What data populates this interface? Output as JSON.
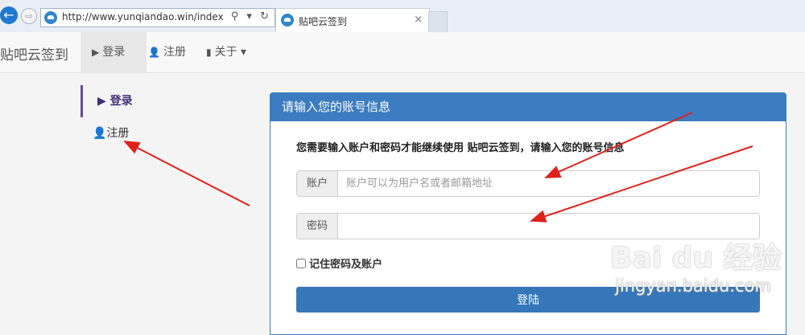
{
  "browser": {
    "url": "http://www.yunqiandao.win/index.ph",
    "tab_title": "贴吧云签到",
    "tab_close": "×",
    "toolbar_glyphs": "⚲ ▾ ↻",
    "back_glyph": "←",
    "forward_glyph": "⇨"
  },
  "navbar": {
    "brand": "贴吧云签到",
    "items": [
      {
        "label": "登录",
        "icon": "play-icon",
        "glyph": "▶"
      },
      {
        "label": "注册",
        "icon": "user-icon",
        "glyph": "👤"
      },
      {
        "label": "关于 ▾",
        "icon": "book-icon",
        "glyph": "▮"
      }
    ]
  },
  "sidenav": {
    "items": [
      {
        "label": "登录",
        "glyph": "▶"
      },
      {
        "label": "注册",
        "glyph": "👤"
      }
    ]
  },
  "panel": {
    "title": "请输入您的账号信息",
    "description": "您需要输入账户和密码才能继续使用 贴吧云签到，请输入您的账号信息",
    "account_label": "账户",
    "account_placeholder": "账户可以为用户名或者邮箱地址",
    "password_label": "密码",
    "remember_label": "记住密码及账户",
    "submit_label": "登陆"
  },
  "watermark": {
    "logo": "Bai du 经验",
    "url": "jingyan.baidu.com"
  },
  "colors": {
    "accent": "#3c7cc0",
    "sidebar_active": "#6a4a9a",
    "annotation": "#e0201b"
  }
}
